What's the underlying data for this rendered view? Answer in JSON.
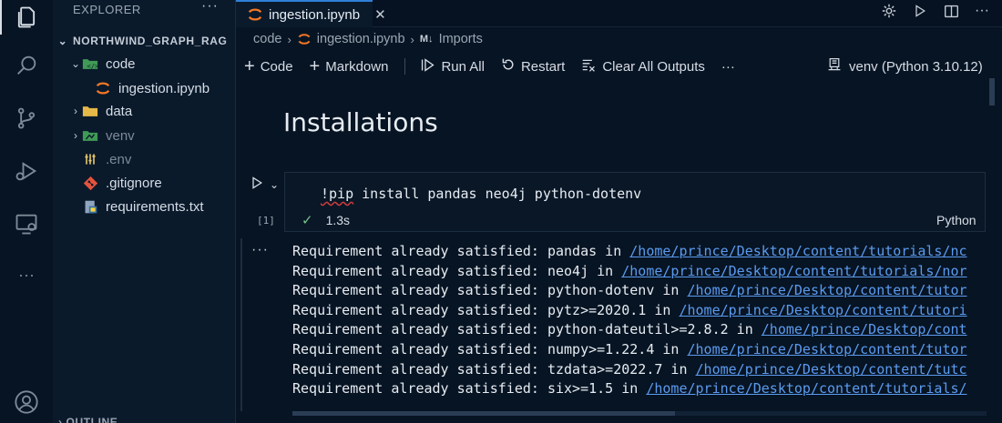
{
  "sidebar": {
    "header": "EXPLORER",
    "more": "···",
    "root": "NORTHWIND_GRAPH_RAG",
    "items": [
      {
        "label": "code",
        "icon": "code-folder-icon",
        "expanded": true
      },
      {
        "label": "ingestion.ipynb",
        "icon": "jupyter-icon"
      },
      {
        "label": "data",
        "icon": "folder-icon",
        "expanded": false
      },
      {
        "label": "venv",
        "icon": "folder-venv-icon",
        "expanded": false
      },
      {
        "label": ".env",
        "icon": "env-icon"
      },
      {
        "label": ".gitignore",
        "icon": "git-icon"
      },
      {
        "label": "requirements.txt",
        "icon": "python-file-icon"
      }
    ],
    "outline": "OUTLINE"
  },
  "tabs": [
    {
      "label": "ingestion.ipynb",
      "close": "✕",
      "active": true
    }
  ],
  "breadcrumb": {
    "folder": "code",
    "file": "ingestion.ipynb",
    "md_badge": "M↓",
    "section": "Imports"
  },
  "toolbar": {
    "code": "Code",
    "markdown": "Markdown",
    "run_all": "Run All",
    "restart": "Restart",
    "clear": "Clear All Outputs",
    "more": "···",
    "kernel": "venv (Python 3.10.12)"
  },
  "notebook": {
    "heading": "Installations",
    "cell": {
      "code_prefix": "!pip",
      "code_rest": " install pandas neo4j python-dotenv",
      "exec_count": "[1]",
      "duration": "1.3s",
      "check": "✓",
      "language": "Python"
    },
    "output_more": "···",
    "output": [
      {
        "text": "Requirement already satisfied: pandas in ",
        "link": "/home/prince/Desktop/content/tutorials/nc"
      },
      {
        "text": "Requirement already satisfied: neo4j in ",
        "link": "/home/prince/Desktop/content/tutorials/nor"
      },
      {
        "text": "Requirement already satisfied: python-dotenv in ",
        "link": "/home/prince/Desktop/content/tutor"
      },
      {
        "text": "Requirement already satisfied: pytz>=2020.1 in ",
        "link": "/home/prince/Desktop/content/tutori"
      },
      {
        "text": "Requirement already satisfied: python-dateutil>=2.8.2 in ",
        "link": "/home/prince/Desktop/cont"
      },
      {
        "text": "Requirement already satisfied: numpy>=1.22.4 in ",
        "link": "/home/prince/Desktop/content/tutor"
      },
      {
        "text": "Requirement already satisfied: tzdata>=2022.7 in ",
        "link": "/home/prince/Desktop/content/tutc"
      },
      {
        "text": "Requirement already satisfied: six>=1.5 in ",
        "link": "/home/prince/Desktop/content/tutorials/"
      }
    ]
  },
  "colors": {
    "background": "#071423",
    "sidebar": "#0a1a2b",
    "accent": "#2f7fd8",
    "link": "#5b9bf0",
    "jupyter": "#f37726",
    "success": "#74c48a"
  }
}
